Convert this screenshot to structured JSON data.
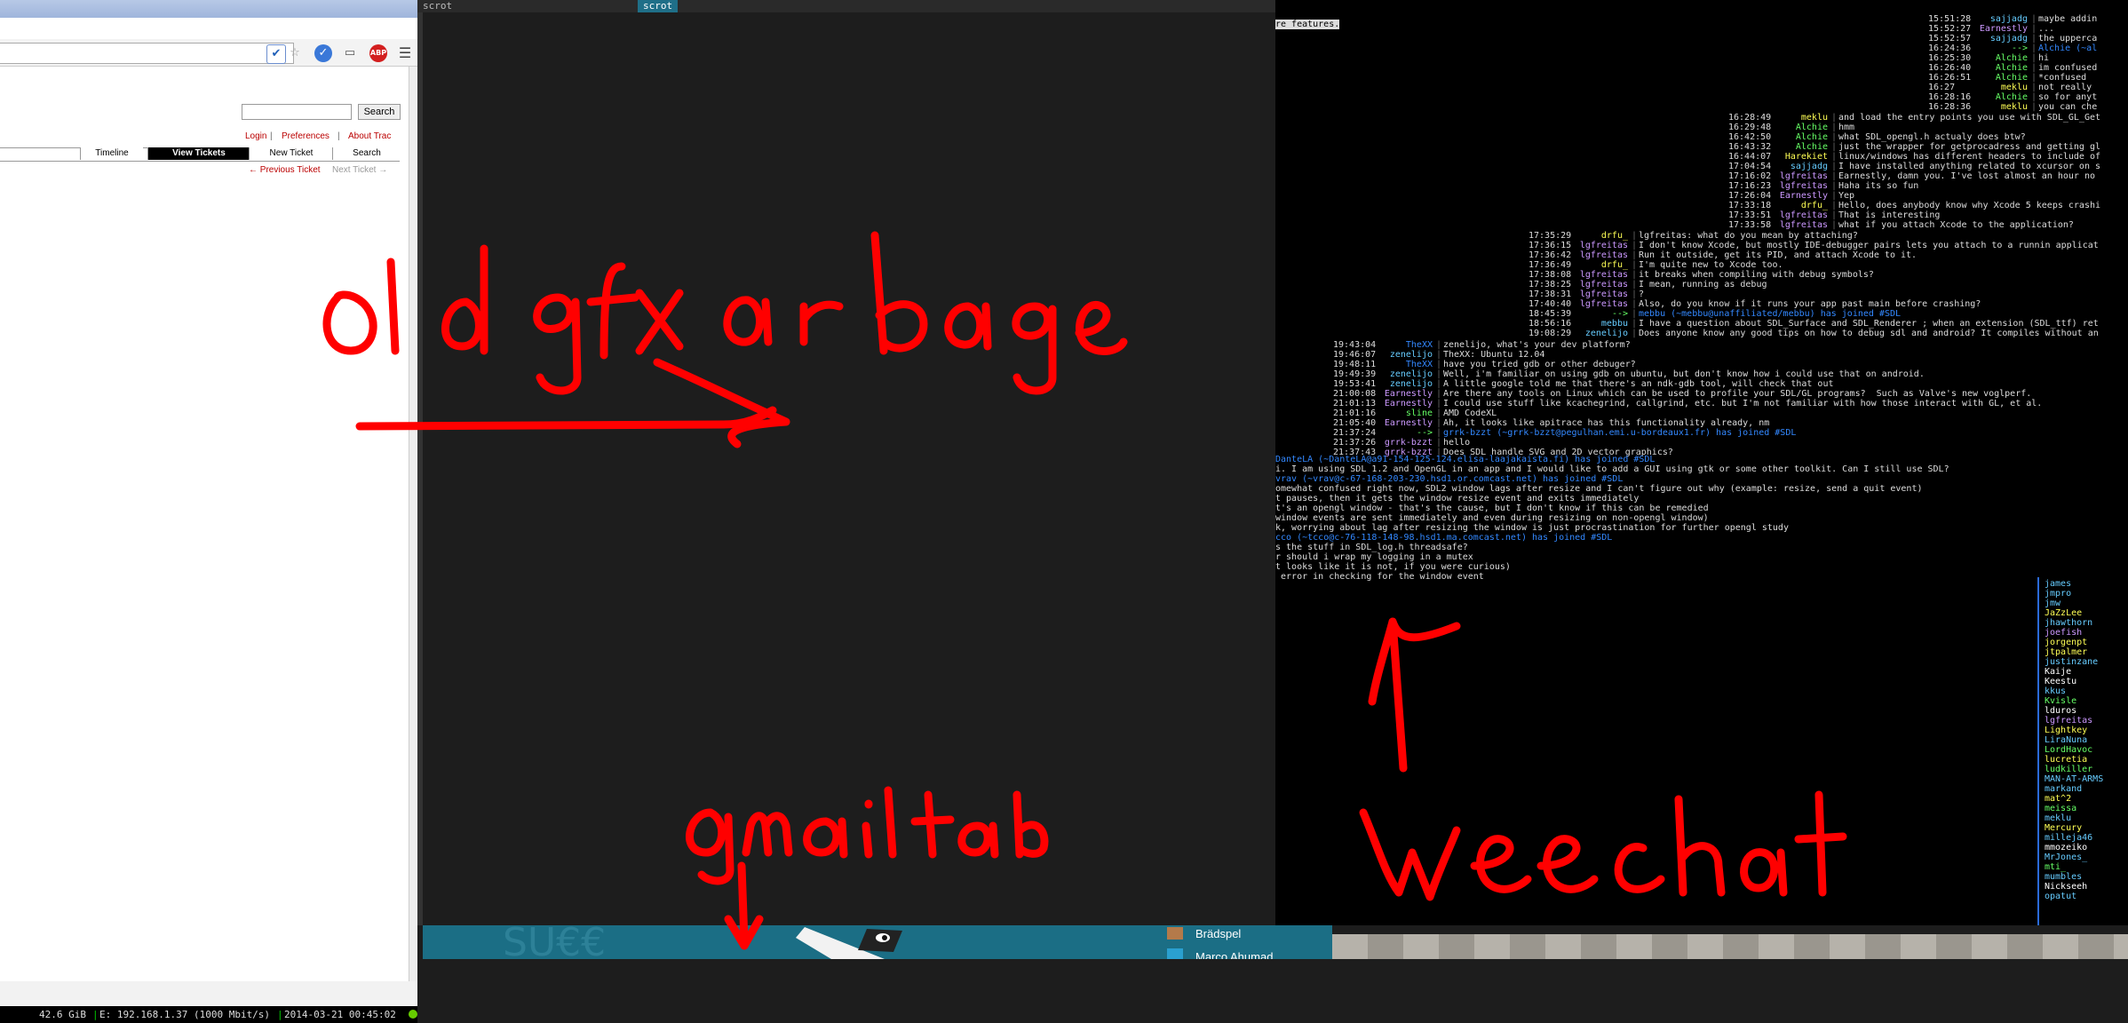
{
  "browser": {
    "search_button": "Search",
    "metanav": {
      "login": "Login",
      "preferences": "Preferences",
      "about": "About Trac"
    },
    "tabs": [
      "Timeline",
      "View Tickets",
      "New Ticket",
      "Search"
    ],
    "active_tab": "View Tickets",
    "prev_ticket": "← Previous Ticket",
    "next_ticket": "Next Ticket →"
  },
  "sysbar": {
    "disk": "42.6 GiB",
    "net": "E: 192.168.1.37 (1000 Mbit/s)",
    "datetime": "2014-03-21 00:45:02"
  },
  "tabbar": {
    "left": "scrot",
    "active": "scrot"
  },
  "annotations": {
    "old_gfx": "old gfx garbage",
    "gmail": "gmail tab",
    "weechat": "weechat"
  },
  "weechat": {
    "top_note": "re features.",
    "block1": [
      {
        "time": "15:51:28",
        "nick": "sajjadg",
        "msg": "maybe addin"
      },
      {
        "time": "15:52:27",
        "nick": "Earnestly",
        "msg": "..."
      },
      {
        "time": "15:52:57",
        "nick": "sajjadg",
        "msg": "the upperca"
      },
      {
        "time": "16:24:36",
        "nick": "-->",
        "msg": "Alchie (~al"
      },
      {
        "time": "16:25:30",
        "nick": "Alchie",
        "msg": "hi"
      },
      {
        "time": "16:26:40",
        "nick": "Alchie",
        "msg": "im confused"
      },
      {
        "time": "16:26:51",
        "nick": "Alchie",
        "msg": "*confused"
      },
      {
        "time": "16:27",
        "nick": "meklu",
        "msg": "not really"
      },
      {
        "time": "16:28:16",
        "nick": "Alchie",
        "msg": "so for anyt"
      },
      {
        "time": "16:28:36",
        "nick": "meklu",
        "msg": "you can che"
      }
    ],
    "block2": [
      {
        "time": "16:28:49",
        "nick": "meklu",
        "msg": "and load the entry points you use with SDL_GL_Get"
      },
      {
        "time": "16:29:48",
        "nick": "Alchie",
        "msg": "hmm"
      },
      {
        "time": "16:42:50",
        "nick": "Alchie",
        "msg": "what SDL_opengl.h actualy does btw?"
      },
      {
        "time": "16:43:32",
        "nick": "Alchie",
        "msg": "just the wrapper for getprocadress and getting gl"
      },
      {
        "time": "16:44:07",
        "nick": "Harekiet",
        "msg": "linux/windows has different headers to include of"
      },
      {
        "time": "17:04:54",
        "nick": "sajjadg",
        "msg": "I have installed anything related to xcursor on s"
      },
      {
        "time": "17:16:02",
        "nick": "lgfreitas",
        "msg": "Earnestly, damn you. I've lost almost an hour no"
      },
      {
        "time": "17:16:23",
        "nick": "lgfreitas",
        "msg": "Haha its so fun"
      },
      {
        "time": "17:26:04",
        "nick": "Earnestly",
        "msg": "Yep"
      },
      {
        "time": "17:33:18",
        "nick": "drfu_",
        "msg": "Hello, does anybody know why Xcode 5 keeps crashi"
      },
      {
        "time": "17:33:51",
        "nick": "lgfreitas",
        "msg": "That is interesting"
      },
      {
        "time": "17:33:58",
        "nick": "lgfreitas",
        "msg": "what if you attach Xcode to the application?"
      }
    ],
    "block3": [
      {
        "time": "17:35:29",
        "nick": "drfu_",
        "msg": "lgfreitas: what do you mean by attaching?"
      },
      {
        "time": "17:36:15",
        "nick": "lgfreitas",
        "msg": "I don't know Xcode, but mostly IDE-debugger pairs lets you attach to a runnin applicat"
      },
      {
        "time": "17:36:42",
        "nick": "lgfreitas",
        "msg": "Run it outside, get its PID, and attach Xcode to it."
      },
      {
        "time": "17:36:49",
        "nick": "drfu_",
        "msg": "I'm quite new to Xcode too."
      },
      {
        "time": "17:38:08",
        "nick": "lgfreitas",
        "msg": "it breaks when compiling with debug symbols?"
      },
      {
        "time": "17:38:25",
        "nick": "lgfreitas",
        "msg": "I mean, running as debug"
      },
      {
        "time": "17:38:31",
        "nick": "lgfreitas",
        "msg": "?"
      },
      {
        "time": "17:40:40",
        "nick": "lgfreitas",
        "msg": "Also, do you know if it runs your app past main before crashing?"
      },
      {
        "time": "18:45:39",
        "nick": "-->",
        "msg": "mebbu (~mebbu@unaffiliated/mebbu) has joined #SDL"
      },
      {
        "time": "18:56:16",
        "nick": "mebbu",
        "msg": "I have a question about SDL_Surface and SDL_Renderer ; when an extension (SDL_ttf) ret"
      },
      {
        "time": "19:08:29",
        "nick": "zenelijo",
        "msg": "Does anyone know any good tips on how to debug sdl and android? It compiles without an"
      }
    ],
    "block4": [
      {
        "time": "19:43:04",
        "nick": "TheXX",
        "msg": "zenelijo, what's your dev platform?"
      },
      {
        "time": "19:46:07",
        "nick": "zenelijo",
        "msg": "TheXX: Ubuntu 12.04"
      },
      {
        "time": "19:48:11",
        "nick": "TheXX",
        "msg": "have you tried gdb or other debuger?"
      },
      {
        "time": "19:49:39",
        "nick": "zenelijo",
        "msg": "Well, i'm familiar on using gdb on ubuntu, but don't know how i could use that on android."
      },
      {
        "time": "19:53:41",
        "nick": "zenelijo",
        "msg": "A little google told me that there's an ndk-gdb tool, will check that out"
      },
      {
        "time": "21:00:08",
        "nick": "Earnestly",
        "msg": "Are there any tools on Linux which can be used to profile your SDL/GL programs?  Such as Valve's new voglperf."
      },
      {
        "time": "21:01:13",
        "nick": "Earnestly",
        "msg": "I could use stuff like kcachegrind, callgrind, etc. but I'm not familiar with how those interact with GL, et al."
      },
      {
        "time": "21:01:16",
        "nick": "sline",
        "msg": "AMD CodeXL"
      },
      {
        "time": "21:05:40",
        "nick": "Earnestly",
        "msg": "Ah, it looks like apitrace has this functionality already, nm"
      },
      {
        "time": "21:37:24",
        "nick": "-->",
        "msg": "grrk-bzzt (~grrk-bzzt@pegulhan.emi.u-bordeaux1.fr) has joined #SDL"
      },
      {
        "time": "21:37:26",
        "nick": "grrk-bzzt",
        "msg": "hello"
      },
      {
        "time": "21:37:43",
        "nick": "grrk-bzzt",
        "msg": "Does SDL handle SVG and 2D vector graphics?"
      }
    ],
    "block5": [
      "DanteLA (~DanteLA@a91-154-125-124.elisa-laajakaista.fi) has joined #SDL",
      "i. I am using SDL 1.2 and OpenGL in an app and I would like to add a GUI using gtk or some other toolkit. Can I still use SDL?",
      "vrav (~vrav@c-67-168-203-230.hsd1.or.comcast.net) has joined #SDL",
      "omewhat confused right now, SDL2 window lags after resize and I can't figure out why (example: resize, send a quit event)",
      "t pauses, then it gets the window resize event and exits immediately",
      "t's an opengl window - that's the cause, but I don't know if this can be remedied",
      "window events are sent immediately and even during resizing on non-opengl window)",
      "k, worrying about lag after resizing the window is just procrastination for further opengl study",
      "cco (~tcco@c-76-118-148-98.hsd1.ma.comcast.net) has joined #SDL",
      "s the stuff in SDL_log.h threadsafe?",
      "r should i wrap my logging in a mutex",
      "t looks like it is not, if you were curious)",
      " error in checking for the window event"
    ],
    "nicklist": [
      "james",
      "jmpro",
      "jmw",
      "JaZzLee",
      "jhawthorn",
      "joefish",
      "jorgenpt",
      "jtpalmer",
      "justinzane",
      "Kaije",
      "Keestu",
      "kkus",
      "Kvisle",
      "lduros",
      "lgfreitas",
      "Lightkey",
      "LiraNuna",
      "LordHavoc",
      "lucretia",
      "ludkiller",
      "MAN-AT-ARMS",
      "markand",
      "mat^2",
      "meissa",
      "meklu",
      "Mercury",
      "milleja46",
      "mmozeiko",
      "MrJones_",
      "mti_",
      "mumbles",
      "Nickseeh",
      "opatut"
    ]
  },
  "gmail": {
    "contact1": "Brädspel",
    "contact2": "Marco Ahumad"
  }
}
